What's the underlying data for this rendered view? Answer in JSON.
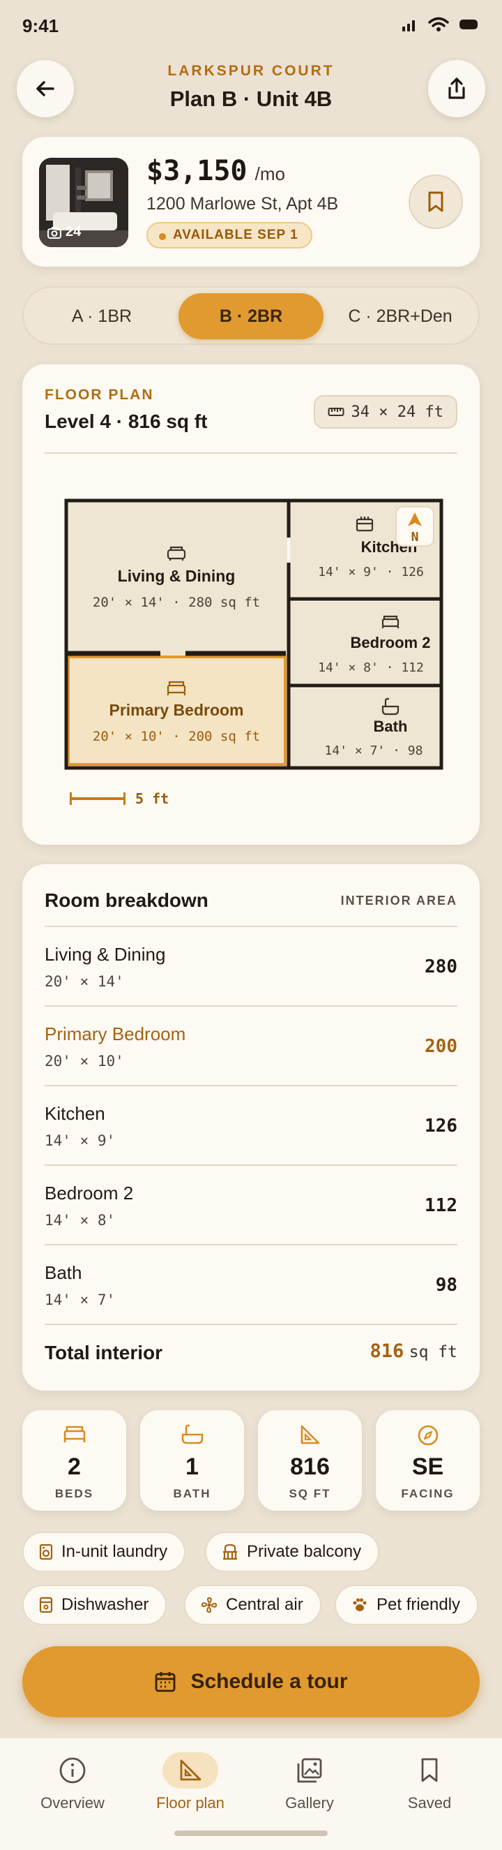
{
  "status_bar": {
    "time": "9:41"
  },
  "header": {
    "subtitle": "LARKSPUR COURT",
    "title": "Plan B · Unit 4B"
  },
  "listing": {
    "photo_count": "24",
    "price": "$3,150",
    "price_unit": "/mo",
    "address": "1200 Marlowe St, Apt 4B",
    "availability": "AVAILABLE SEP 1"
  },
  "plan_tabs": [
    {
      "label": "A · 1BR",
      "active": false
    },
    {
      "label": "B · 2BR",
      "active": true
    },
    {
      "label": "C · 2BR+Den",
      "active": false
    }
  ],
  "floor_plan": {
    "section_label": "FLOOR PLAN",
    "level": "Level 4 · 816 sq ft",
    "dimensions": "34 × 24 ft",
    "compass": "N",
    "scale": "5 ft",
    "rooms": {
      "living": {
        "name": "Living & Dining",
        "dims": "20' × 14' · 280 sq ft"
      },
      "kitchen": {
        "name": "Kitchen",
        "dims": "14' × 9' · 126"
      },
      "bedroom2": {
        "name": "Bedroom 2",
        "dims": "14' × 8' · 112"
      },
      "primary": {
        "name": "Primary Bedroom",
        "dims": "20' × 10' · 200 sq ft"
      },
      "bath": {
        "name": "Bath",
        "dims": "14' × 7' · 98"
      }
    }
  },
  "breakdown": {
    "title": "Room breakdown",
    "subtitle": "INTERIOR AREA",
    "rows": [
      {
        "name": "Living & Dining",
        "dims": "20' × 14'",
        "value": "280"
      },
      {
        "name": "Primary Bedroom",
        "dims": "20' × 10'",
        "value": "200"
      },
      {
        "name": "Kitchen",
        "dims": "14' × 9'",
        "value": "126"
      },
      {
        "name": "Bedroom 2",
        "dims": "14' × 8'",
        "value": "112"
      },
      {
        "name": "Bath",
        "dims": "14' × 7'",
        "value": "98"
      }
    ],
    "total_label": "Total interior",
    "total_value": "816",
    "total_unit": "sq ft"
  },
  "stats": [
    {
      "value": "2",
      "label": "BEDS",
      "icon": "bed-icon"
    },
    {
      "value": "1",
      "label": "BATH",
      "icon": "bathtub-icon"
    },
    {
      "value": "816",
      "label": "SQ FT",
      "icon": "set-square-icon"
    },
    {
      "value": "SE",
      "label": "FACING",
      "icon": "compass-icon"
    }
  ],
  "amenities": [
    {
      "label": "In-unit laundry",
      "icon": "washer-icon"
    },
    {
      "label": "Private balcony",
      "icon": "balcony-icon"
    },
    {
      "label": "Dishwasher",
      "icon": "dishwasher-icon"
    },
    {
      "label": "Central air",
      "icon": "fan-icon"
    },
    {
      "label": "Pet friendly",
      "icon": "paw-icon"
    }
  ],
  "cta": {
    "label": "Schedule a tour"
  },
  "bottom_nav": [
    {
      "label": "Overview",
      "icon": "info-icon",
      "active": false
    },
    {
      "label": "Floor plan",
      "icon": "floor-plan-icon",
      "active": true
    },
    {
      "label": "Gallery",
      "icon": "gallery-icon",
      "active": false
    },
    {
      "label": "Saved",
      "icon": "bookmark-icon",
      "active": false
    }
  ],
  "colors": {
    "accent": "#e19a2f",
    "accent_text": "#b46c12",
    "background": "#ebe2d3",
    "card": "#fdfaf4",
    "highlight_room": "#f4e4c4"
  }
}
